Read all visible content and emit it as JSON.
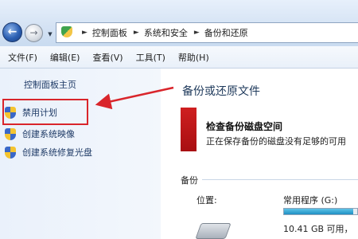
{
  "breadcrumb": [
    "控制面板",
    "系统和安全",
    "备份和还原"
  ],
  "menu": [
    "文件(F)",
    "编辑(E)",
    "查看(V)",
    "工具(T)",
    "帮助(H)"
  ],
  "left_pane": {
    "home_link": "控制面板主页",
    "tasks": [
      {
        "label": "禁用计划",
        "icon": "uac-shield-icon"
      },
      {
        "label": "创建系统映像",
        "icon": "uac-shield-icon"
      },
      {
        "label": "创建系统修复光盘",
        "icon": "uac-shield-icon"
      }
    ]
  },
  "main": {
    "title": "备份或还原文件",
    "alert": {
      "title": "检查备份磁盘空间",
      "text": "正在保存备份的磁盘没有足够的可用",
      "color": "#c8171a"
    },
    "backup": {
      "section": "备份",
      "location_label": "位置:",
      "drive_name": "常用程序 (G:)",
      "drive_free": "10.41 GB 可用，",
      "drive_usage_percent": 95
    }
  },
  "colors": {
    "highlight": "#d9252b",
    "link": "#1e3a66"
  }
}
